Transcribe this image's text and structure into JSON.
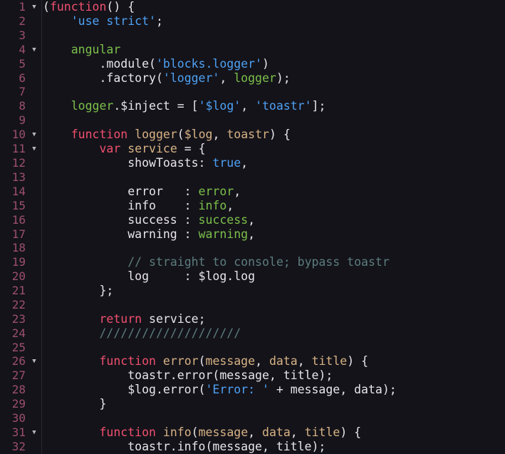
{
  "editor": {
    "language": "JavaScript",
    "theme_background": "#14131a",
    "gutter_separator_color": "#2b2733",
    "line_number_color": "#9c4f6d",
    "fold_arrow_glyph": "▼",
    "colors": {
      "plain": "#e8e6ea",
      "keyword": "#f0506e",
      "string": "#4ea1f3",
      "identifier": "#7cc04a",
      "parameter": "#d8b384",
      "comment": "#5c7d7d"
    },
    "lines": [
      {
        "n": "1",
        "fold": true,
        "tokens": [
          {
            "t": "(",
            "c": "punc"
          },
          {
            "t": "function",
            "c": "kw"
          },
          {
            "t": "() {",
            "c": "punc"
          }
        ]
      },
      {
        "n": "2",
        "fold": false,
        "tokens": [
          {
            "t": "    ",
            "c": "plain"
          },
          {
            "t": "'use strict'",
            "c": "str"
          },
          {
            "t": ";",
            "c": "punc"
          }
        ]
      },
      {
        "n": "3",
        "fold": false,
        "tokens": []
      },
      {
        "n": "4",
        "fold": true,
        "tokens": [
          {
            "t": "    ",
            "c": "plain"
          },
          {
            "t": "angular",
            "c": "ident"
          }
        ]
      },
      {
        "n": "5",
        "fold": false,
        "tokens": [
          {
            "t": "        .module(",
            "c": "plain"
          },
          {
            "t": "'blocks.logger'",
            "c": "str"
          },
          {
            "t": ")",
            "c": "punc"
          }
        ]
      },
      {
        "n": "6",
        "fold": false,
        "tokens": [
          {
            "t": "        .factory(",
            "c": "plain"
          },
          {
            "t": "'logger'",
            "c": "str"
          },
          {
            "t": ", ",
            "c": "punc"
          },
          {
            "t": "logger",
            "c": "ident"
          },
          {
            "t": ");",
            "c": "punc"
          }
        ]
      },
      {
        "n": "7",
        "fold": false,
        "tokens": []
      },
      {
        "n": "8",
        "fold": false,
        "tokens": [
          {
            "t": "    ",
            "c": "plain"
          },
          {
            "t": "logger",
            "c": "ident"
          },
          {
            "t": ".$inject = [",
            "c": "plain"
          },
          {
            "t": "'$log'",
            "c": "str"
          },
          {
            "t": ", ",
            "c": "punc"
          },
          {
            "t": "'toastr'",
            "c": "str"
          },
          {
            "t": "];",
            "c": "punc"
          }
        ]
      },
      {
        "n": "9",
        "fold": false,
        "tokens": []
      },
      {
        "n": "10",
        "fold": true,
        "tokens": [
          {
            "t": "    ",
            "c": "plain"
          },
          {
            "t": "function",
            "c": "kw"
          },
          {
            "t": " ",
            "c": "plain"
          },
          {
            "t": "logger",
            "c": "param"
          },
          {
            "t": "(",
            "c": "punc"
          },
          {
            "t": "$log",
            "c": "param"
          },
          {
            "t": ", ",
            "c": "punc"
          },
          {
            "t": "toastr",
            "c": "param"
          },
          {
            "t": ") {",
            "c": "punc"
          }
        ]
      },
      {
        "n": "11",
        "fold": true,
        "tokens": [
          {
            "t": "        ",
            "c": "plain"
          },
          {
            "t": "var",
            "c": "kw"
          },
          {
            "t": " ",
            "c": "plain"
          },
          {
            "t": "service",
            "c": "param"
          },
          {
            "t": " = {",
            "c": "punc"
          }
        ]
      },
      {
        "n": "12",
        "fold": false,
        "tokens": [
          {
            "t": "            showToasts: ",
            "c": "plain"
          },
          {
            "t": "true",
            "c": "num"
          },
          {
            "t": ",",
            "c": "punc"
          }
        ]
      },
      {
        "n": "13",
        "fold": false,
        "tokens": []
      },
      {
        "n": "14",
        "fold": false,
        "tokens": [
          {
            "t": "            error   : ",
            "c": "plain"
          },
          {
            "t": "error",
            "c": "ident"
          },
          {
            "t": ",",
            "c": "punc"
          }
        ]
      },
      {
        "n": "15",
        "fold": false,
        "tokens": [
          {
            "t": "            info    : ",
            "c": "plain"
          },
          {
            "t": "info",
            "c": "ident"
          },
          {
            "t": ",",
            "c": "punc"
          }
        ]
      },
      {
        "n": "16",
        "fold": false,
        "tokens": [
          {
            "t": "            success : ",
            "c": "plain"
          },
          {
            "t": "success",
            "c": "ident"
          },
          {
            "t": ",",
            "c": "punc"
          }
        ]
      },
      {
        "n": "17",
        "fold": false,
        "tokens": [
          {
            "t": "            warning : ",
            "c": "plain"
          },
          {
            "t": "warning",
            "c": "ident"
          },
          {
            "t": ",",
            "c": "punc"
          }
        ]
      },
      {
        "n": "18",
        "fold": false,
        "tokens": []
      },
      {
        "n": "19",
        "fold": false,
        "tokens": [
          {
            "t": "            ",
            "c": "plain"
          },
          {
            "t": "// straight to console; bypass toastr",
            "c": "comment"
          }
        ]
      },
      {
        "n": "20",
        "fold": false,
        "tokens": [
          {
            "t": "            log     : $log.log",
            "c": "plain"
          }
        ]
      },
      {
        "n": "21",
        "fold": false,
        "tokens": [
          {
            "t": "        };",
            "c": "punc"
          }
        ]
      },
      {
        "n": "22",
        "fold": false,
        "tokens": []
      },
      {
        "n": "23",
        "fold": false,
        "tokens": [
          {
            "t": "        ",
            "c": "plain"
          },
          {
            "t": "return",
            "c": "kw"
          },
          {
            "t": " service;",
            "c": "plain"
          }
        ]
      },
      {
        "n": "24",
        "fold": false,
        "tokens": [
          {
            "t": "        ",
            "c": "plain"
          },
          {
            "t": "////////////////////",
            "c": "comment"
          }
        ]
      },
      {
        "n": "25",
        "fold": false,
        "tokens": []
      },
      {
        "n": "26",
        "fold": true,
        "tokens": [
          {
            "t": "        ",
            "c": "plain"
          },
          {
            "t": "function",
            "c": "kw"
          },
          {
            "t": " ",
            "c": "plain"
          },
          {
            "t": "error",
            "c": "param"
          },
          {
            "t": "(",
            "c": "punc"
          },
          {
            "t": "message",
            "c": "param"
          },
          {
            "t": ", ",
            "c": "punc"
          },
          {
            "t": "data",
            "c": "param"
          },
          {
            "t": ", ",
            "c": "punc"
          },
          {
            "t": "title",
            "c": "param"
          },
          {
            "t": ") {",
            "c": "punc"
          }
        ]
      },
      {
        "n": "27",
        "fold": false,
        "tokens": [
          {
            "t": "            toastr.error(message, title);",
            "c": "plain"
          }
        ]
      },
      {
        "n": "28",
        "fold": false,
        "tokens": [
          {
            "t": "            $log.error(",
            "c": "plain"
          },
          {
            "t": "'Error: '",
            "c": "str"
          },
          {
            "t": " + message, data);",
            "c": "plain"
          }
        ]
      },
      {
        "n": "29",
        "fold": false,
        "tokens": [
          {
            "t": "        }",
            "c": "punc"
          }
        ]
      },
      {
        "n": "30",
        "fold": false,
        "tokens": []
      },
      {
        "n": "31",
        "fold": true,
        "tokens": [
          {
            "t": "        ",
            "c": "plain"
          },
          {
            "t": "function",
            "c": "kw"
          },
          {
            "t": " ",
            "c": "plain"
          },
          {
            "t": "info",
            "c": "param"
          },
          {
            "t": "(",
            "c": "punc"
          },
          {
            "t": "message",
            "c": "param"
          },
          {
            "t": ", ",
            "c": "punc"
          },
          {
            "t": "data",
            "c": "param"
          },
          {
            "t": ", ",
            "c": "punc"
          },
          {
            "t": "title",
            "c": "param"
          },
          {
            "t": ") {",
            "c": "punc"
          }
        ]
      },
      {
        "n": "32",
        "fold": false,
        "tokens": [
          {
            "t": "            toastr.info(message, title);",
            "c": "plain"
          }
        ]
      }
    ]
  }
}
